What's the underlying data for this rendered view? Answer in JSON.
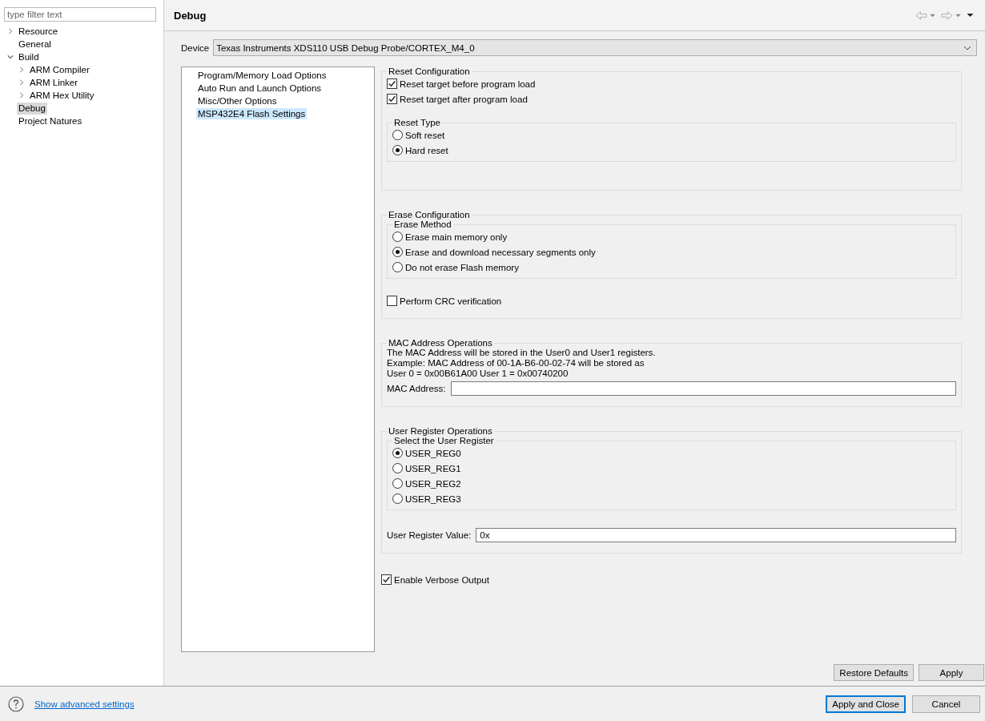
{
  "sidebar": {
    "filter": {
      "placeholder": "type filter text"
    },
    "items": [
      {
        "label": "Resource",
        "expanded": false,
        "selected": false
      },
      {
        "label": "General",
        "selected": false
      },
      {
        "label": "Build",
        "expanded": true,
        "selected": false,
        "children": [
          {
            "label": "ARM Compiler",
            "expanded": false,
            "selected": false
          },
          {
            "label": "ARM Linker",
            "expanded": false,
            "selected": false
          },
          {
            "label": "ARM Hex Utility",
            "expanded": false,
            "selected": false
          }
        ]
      },
      {
        "label": "Debug",
        "selected": true
      },
      {
        "label": "Project Natures",
        "selected": false
      }
    ]
  },
  "page": {
    "title": "Debug",
    "device": {
      "label": "Device",
      "value": "Texas Instruments XDS110 USB Debug Probe/CORTEX_M4_0"
    },
    "categories": [
      {
        "label": "Program/Memory Load Options",
        "selected": false
      },
      {
        "label": "Auto Run and Launch Options",
        "selected": false
      },
      {
        "label": "Misc/Other Options",
        "selected": false
      },
      {
        "label": "MSP432E4 Flash Settings",
        "selected": true
      }
    ],
    "reset_configuration": {
      "title": "Reset Configuration",
      "checkboxes": [
        {
          "label": "Reset target before program load",
          "checked": true
        },
        {
          "label": "Reset target after program load",
          "checked": true
        }
      ],
      "reset_type": {
        "title": "Reset Type",
        "options": [
          {
            "label": "Soft reset",
            "selected": false
          },
          {
            "label": "Hard reset",
            "selected": true
          }
        ]
      }
    },
    "erase_configuration": {
      "title": "Erase Configuration",
      "erase_method": {
        "title": "Erase Method",
        "options": [
          {
            "label": "Erase main memory only",
            "selected": false
          },
          {
            "label": "Erase and download necessary segments only",
            "selected": true
          },
          {
            "label": "Do not erase Flash memory",
            "selected": false
          }
        ]
      },
      "crc": {
        "label": "Perform CRC verification",
        "checked": false
      }
    },
    "mac_address_operations": {
      "title": "MAC Address Operations",
      "lines": [
        "The MAC Address will be stored in the User0 and User1 registers.",
        "Example: MAC Address of 00-1A-B6-00-02-74 will be stored as",
        "User 0 = 0x00B61A00 User 1 = 0x00740200"
      ],
      "field": {
        "label": "MAC Address:"
      }
    },
    "user_register_operations": {
      "title": "User Register Operations",
      "select": {
        "title": "Select the User Register",
        "options": [
          {
            "label": "USER_REG0",
            "selected": true
          },
          {
            "label": "USER_REG1",
            "selected": false
          },
          {
            "label": "USER_REG2",
            "selected": false
          },
          {
            "label": "USER_REG3",
            "selected": false
          }
        ]
      },
      "field": {
        "label": "User Register Value:",
        "value": "0x"
      }
    },
    "verbose": {
      "label": "Enable Verbose Output",
      "checked": true
    },
    "buttons": [
      "Restore Defaults",
      "Apply"
    ]
  },
  "footer": {
    "link": "Show advanced settings",
    "buttons": [
      {
        "label": "Apply and Close",
        "default": true
      },
      {
        "label": "Cancel",
        "default": false
      }
    ]
  }
}
